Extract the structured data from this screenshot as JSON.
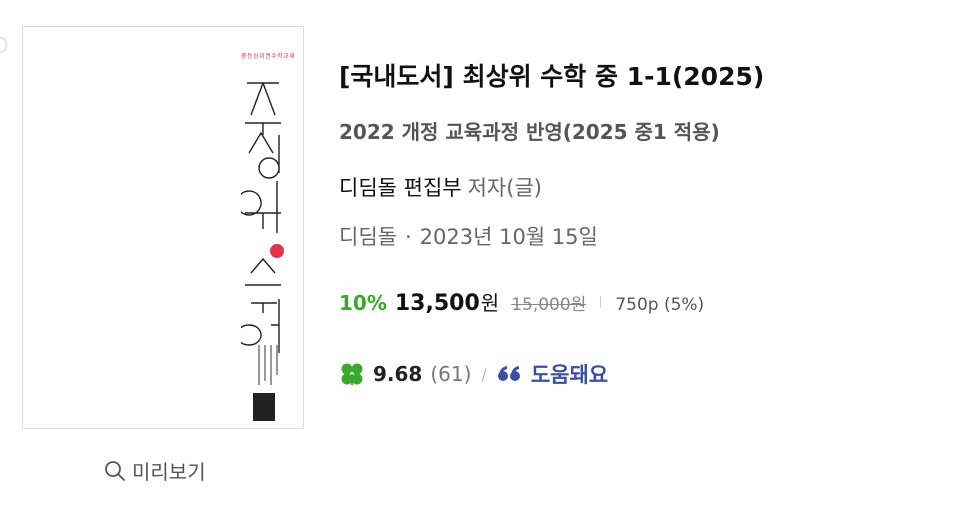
{
  "book": {
    "category": "[국내도서]",
    "title": "최상위 수학 중 1-1(2025)",
    "subtitle": "2022 개정 교육과정 반영(2025 중1 적용)",
    "author": "디딤돌 편집부",
    "author_role": "저자(글)",
    "publisher": "디딤돌",
    "separator": "·",
    "publish_date": "2023년 10월 15일"
  },
  "cover": {
    "tagline": "중등상위권수학교재",
    "title_text": "최상위 수학"
  },
  "price": {
    "discount": "10%",
    "sale_price": "13,500",
    "currency": "원",
    "original_price": "15,000원",
    "points": "750p (5%)"
  },
  "rating": {
    "score": "9.68",
    "count": "(61)",
    "slash": "/",
    "helpful_label": "도움돼요"
  },
  "preview": {
    "label": "미리보기"
  },
  "colors": {
    "discount": "#3ba82c",
    "clover": "#3ba82c",
    "helpful": "#3b4f9e",
    "cover_accent": "#e0334d"
  }
}
